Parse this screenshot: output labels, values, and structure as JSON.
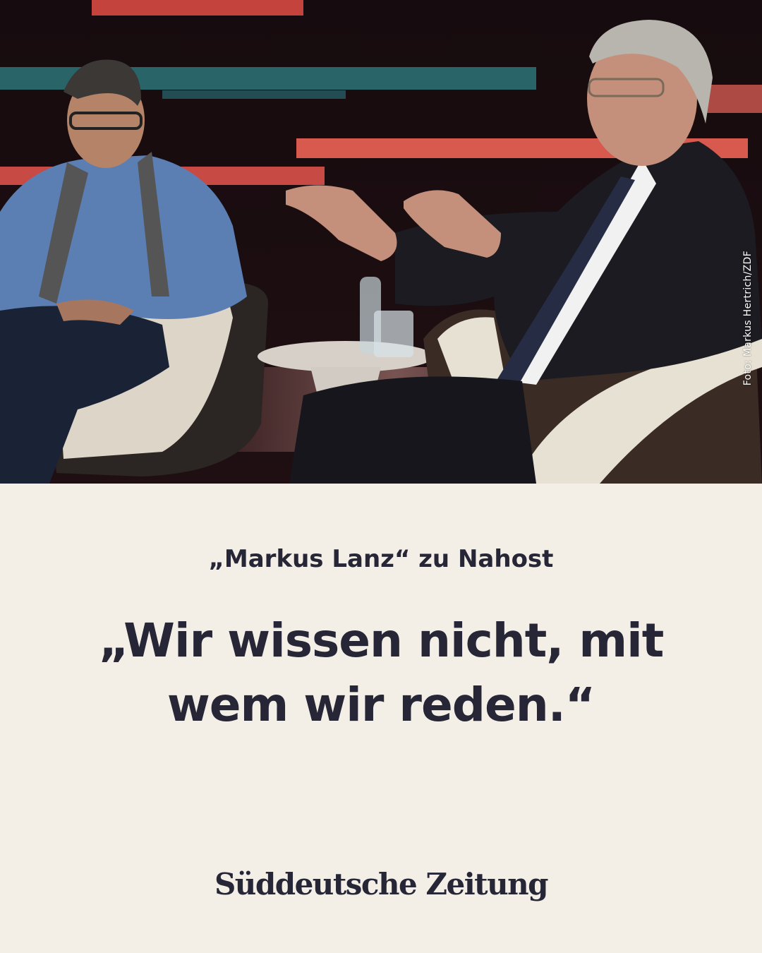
{
  "photo": {
    "credit": "Foto: Markus Hertrich/ZDF"
  },
  "kicker": "„Markus Lanz“ zu Nahost",
  "headline": "„Wir wissen nicht, mit wem wir reden.“",
  "brand": {
    "logo_text": "Süddeutsche Zeitung"
  },
  "colors": {
    "background": "#f3efe6",
    "text": "#262637"
  }
}
